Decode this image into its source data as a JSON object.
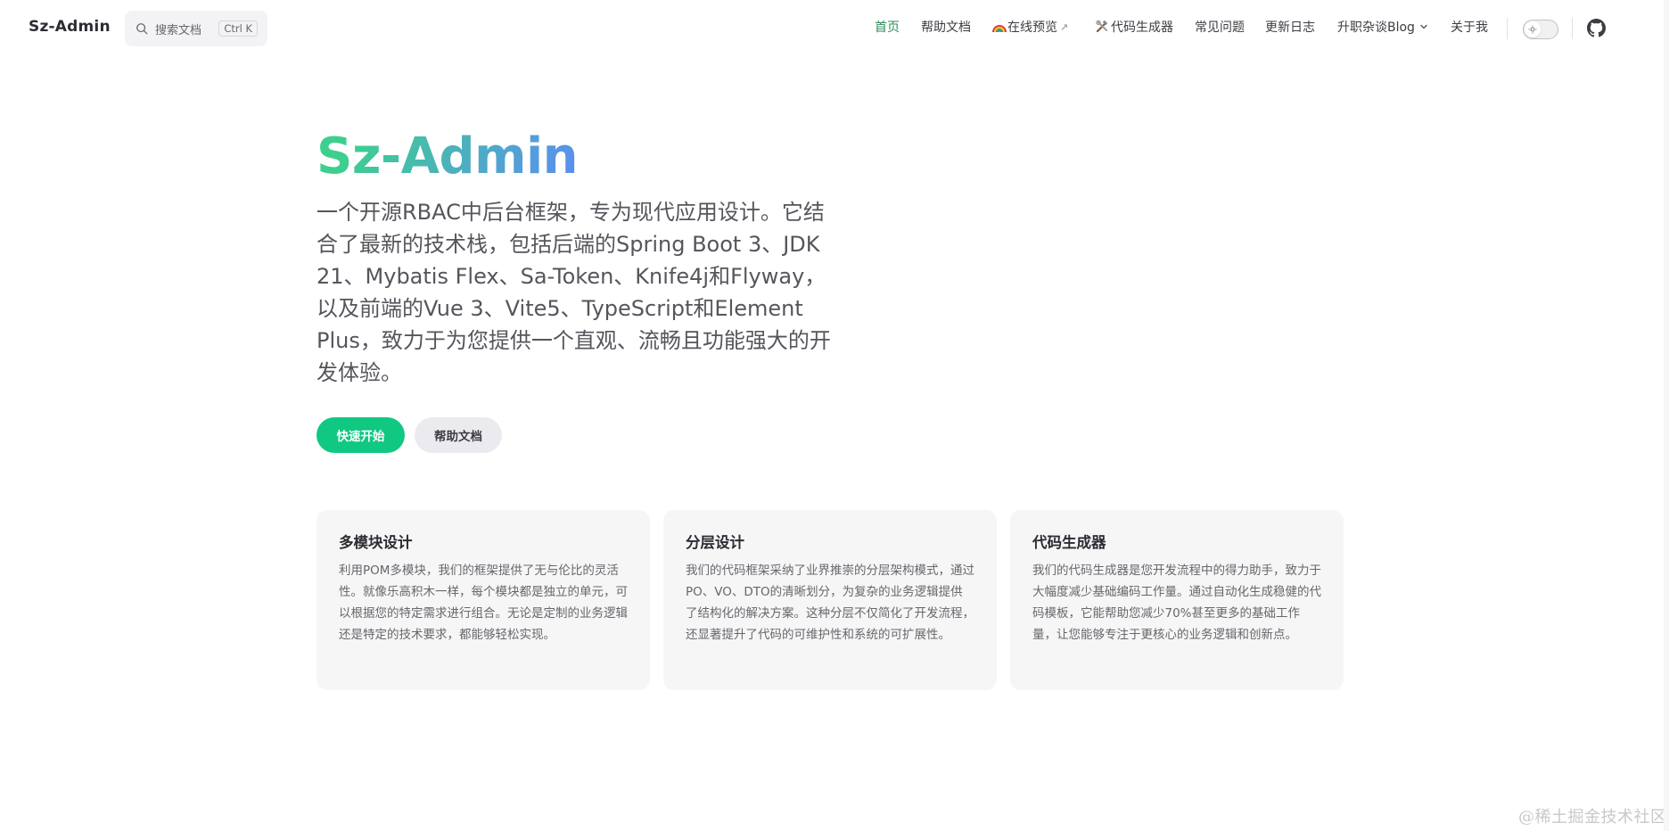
{
  "nav": {
    "brand": "Sz-Admin",
    "search": {
      "placeholder": "搜索文档",
      "shortcut": "Ctrl K"
    },
    "items": [
      {
        "label": "首页",
        "active": true
      },
      {
        "label": "帮助文档"
      },
      {
        "label": "在线预览",
        "icon": "rainbow-icon",
        "external": "↗"
      },
      {
        "label": "代码生成器",
        "icon": "tools-icon"
      },
      {
        "label": "常见问题"
      },
      {
        "label": "更新日志"
      },
      {
        "label": "升职杂谈Blog",
        "dropdown": "⌄"
      },
      {
        "label": "关于我"
      }
    ],
    "theme_toggle_icon": "sun-icon",
    "github_icon": "github-icon"
  },
  "hero": {
    "title": "Sz-Admin",
    "tagline": "一个开源RBAC中后台框架，专为现代应用设计。它结合了最新的技术栈，包括后端的Spring Boot 3、JDK 21、Mybatis Flex、Sa-Token、Knife4j和Flyway，以及前端的Vue 3、Vite5、TypeScript和Element Plus，致力于为您提供一个直观、流畅且功能强大的开发体验。",
    "primary_button": "快速开始",
    "secondary_button": "帮助文档"
  },
  "features": [
    {
      "title": "多模块设计",
      "desc": "利用POM多模块，我们的框架提供了无与伦比的灵活性。就像乐高积木一样，每个模块都是独立的单元，可以根据您的特定需求进行组合。无论是定制的业务逻辑还是特定的技术要求，都能够轻松实现。"
    },
    {
      "title": "分层设计",
      "desc": "我们的代码框架采纳了业界推崇的分层架构模式，通过PO、VO、DTO的清晰划分，为复杂的业务逻辑提供了结构化的解决方案。这种分层不仅简化了开发流程，还显著提升了代码的可维护性和系统的可扩展性。"
    },
    {
      "title": "代码生成器",
      "desc": "我们的代码生成器是您开发流程中的得力助手，致力于大幅度减少基础编码工作量。通过自动化生成稳健的代码模板，它能帮助您减少70%甚至更多的基础工作量，让您能够专注于更核心的业务逻辑和创新点。"
    }
  ],
  "watermark": "@稀土掘金技术社区",
  "colors": {
    "accent": "#10c882",
    "active_nav": "#2f8a5b",
    "gradient_start": "#3ecf8e",
    "gradient_end": "#5b8ff0"
  }
}
